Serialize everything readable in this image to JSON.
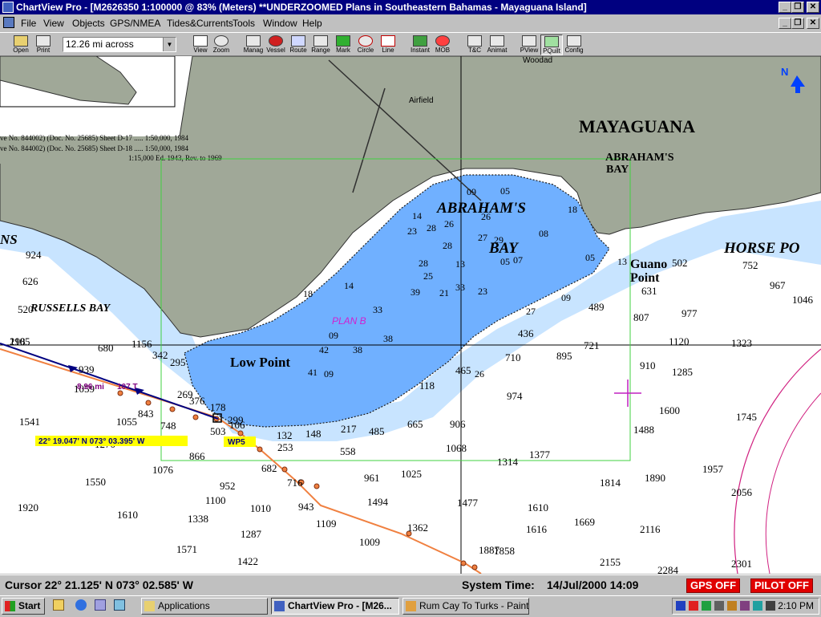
{
  "window": {
    "title": "ChartView Pro - [M2626350 1:100000 @ 83% (Meters) **UNDERZOOMED Plans in Southeastern Bahamas - Mayaguana Island]",
    "min_symbol": "_",
    "max_symbol": "❐",
    "close_symbol": "✕"
  },
  "menu": [
    "File",
    "View",
    "Objects",
    "GPS/NMEA",
    "Tides&Currents",
    "Tools",
    "Window",
    "Help"
  ],
  "toolbar": {
    "scale_value": "12.26 mi across",
    "buttons": [
      "Open",
      "Print",
      "View",
      "Zoom",
      "Manag",
      "Vessel",
      "Route",
      "Range",
      "Mark",
      "Circle",
      "Line",
      "Instant",
      "MOB",
      "T&C",
      "Animat",
      "PView",
      "PQuilt",
      "Config"
    ]
  },
  "chart": {
    "place_labels": [
      "MAYAGUANA",
      "ABRAHAM'S",
      "BAY",
      "ABRAHAM'S",
      "BAY",
      "HORSE PO",
      "Guano",
      "Point",
      "RUSSELLS BAY",
      "Low Point",
      "Airfield",
      "Woodad",
      "PLAN B",
      "NS"
    ],
    "source_notes": [
      "ve No. 844002) (Doc. No. 25685) Sheet D-17 ..... 1:50,000, 1984",
      "ve No. 844002) (Doc. No. 25685) Sheet D-18 ..... 1:50,000, 1984",
      "1:15,000 Ed. 1943, Rev. to 1969"
    ],
    "north_label": "N",
    "route_distance": "8.96 mi",
    "route_bearing": "107 T",
    "position_label": "22° 19.047' N  073° 03.395' W",
    "waypoint_label": "WP5",
    "deep_soundings": [
      "1105",
      "680",
      "939",
      "1059",
      "1541",
      "1055",
      "843",
      "748",
      "1270",
      "503",
      "866",
      "1076",
      "1550",
      "952",
      "1100",
      "1010",
      "943",
      "1109",
      "1920",
      "1610",
      "1338",
      "1287",
      "1571",
      "1422",
      "682",
      "716",
      "961",
      "1025",
      "1009",
      "1362",
      "1494",
      "558",
      "1068",
      "1314",
      "1377",
      "1477",
      "1610",
      "1616",
      "1669",
      "1858",
      "1887",
      "1814",
      "1890",
      "1488",
      "1600",
      "1745",
      "1957",
      "2056",
      "2116",
      "2155",
      "2284",
      "2301",
      "1285",
      "910",
      "977",
      "807",
      "1120",
      "1323",
      "721",
      "895",
      "710",
      "974",
      "906",
      "665",
      "485",
      "217",
      "631",
      "489",
      "436",
      "465",
      "502",
      "752",
      "967",
      "1046",
      "626",
      "924",
      "520",
      "295",
      "1156",
      "342",
      "269",
      "376",
      "178",
      "106",
      "253",
      "299",
      "148",
      "132",
      "118",
      "298"
    ],
    "shallow_soundings": [
      "23",
      "28",
      "28",
      "26",
      "28",
      "13",
      "14",
      "09",
      "05",
      "27",
      "29",
      "25",
      "21",
      "23",
      "26",
      "05",
      "09",
      "14",
      "09",
      "33",
      "38",
      "42",
      "41",
      "38",
      "07",
      "08",
      "09",
      "18",
      "39",
      "33",
      "18",
      "05",
      "13",
      "26",
      "27"
    ]
  },
  "status": {
    "cursor": "Cursor 22° 21.125' N  073° 02.585' W",
    "system_time_label": "System Time:",
    "system_time_value": "14/Jul/2000  14:09",
    "gps": "GPS OFF",
    "pilot": "PILOT OFF"
  },
  "taskbar": {
    "start": "Start",
    "items": [
      "Applications",
      "ChartView Pro - [M26...",
      "Rum Cay To Turks - Paint"
    ],
    "clock": "2:10 PM"
  },
  "colors": {
    "title_bar": "#000080",
    "land": "#a0a898",
    "shallow_water": "#70b0ff",
    "band_water": "#c8e4ff",
    "route": "#f08040",
    "track": "#000080",
    "alert": "#e00000",
    "highlight": "#ffff00"
  }
}
